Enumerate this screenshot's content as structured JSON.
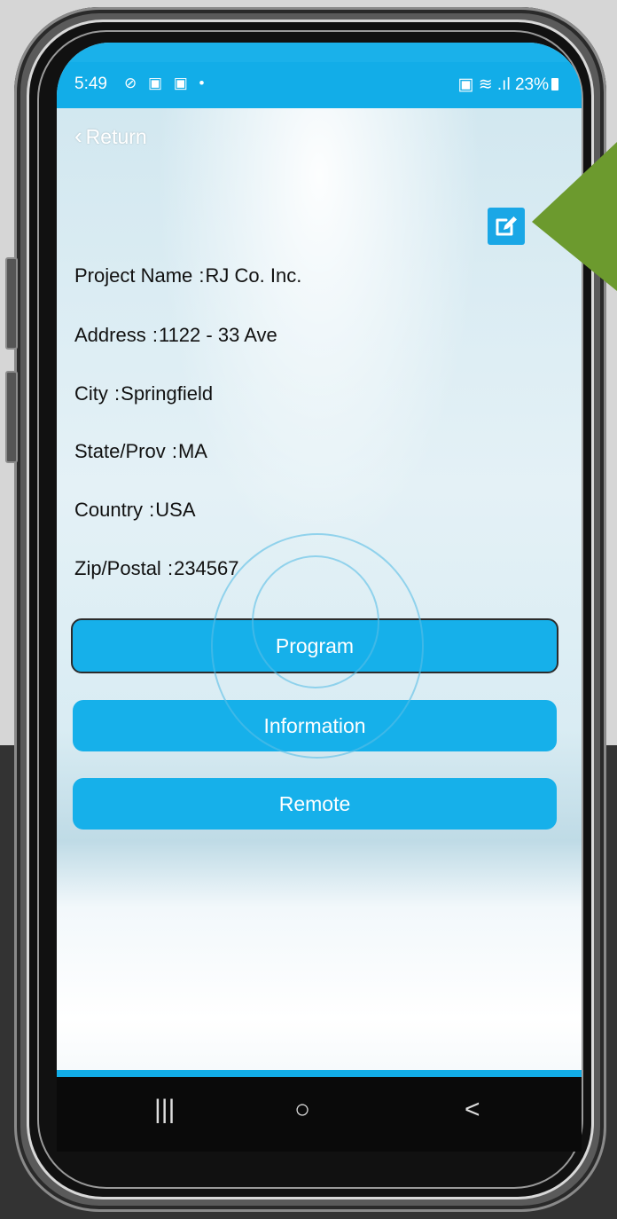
{
  "status_bar": {
    "time": "5:49",
    "left_icons": "⊘ ▣ ▣ •",
    "right_icons": "▣ ≋ .ıl",
    "battery": "23%"
  },
  "nav": {
    "return_label": "Return"
  },
  "project": {
    "fields": [
      {
        "label": "Project Name",
        "value": "RJ Co. Inc."
      },
      {
        "label": "Address",
        "value": "1122 - 33 Ave"
      },
      {
        "label": "City",
        "value": "Springfield"
      },
      {
        "label": "State/Prov",
        "value": "MA"
      },
      {
        "label": "Country",
        "value": "USA"
      },
      {
        "label": "Zip/Postal",
        "value": "234567"
      }
    ],
    "separator": ":"
  },
  "buttons": {
    "program": "Program",
    "information": "Information",
    "remote": "Remote"
  },
  "system_nav": {
    "recents": "|||",
    "home": "○",
    "back": "<"
  },
  "colors": {
    "accent": "#12ADE8",
    "callout": "#6C9A2E"
  }
}
